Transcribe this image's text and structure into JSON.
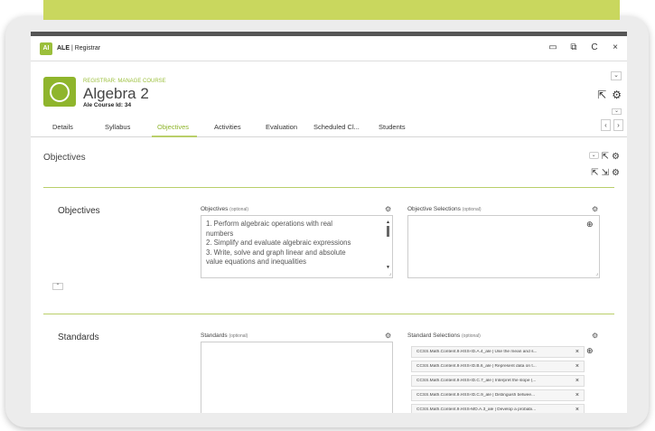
{
  "app": {
    "logo": "AI",
    "title_bold": "ALE",
    "title_rest": " | Registrar",
    "window_controls": [
      "▭",
      "⧉",
      "C",
      "×"
    ]
  },
  "header": {
    "breadcrumb": "REGISTRAR: MANAGE COURSE",
    "course_name": "Algebra 2",
    "course_id": "Ale Course Id: 34",
    "icons": [
      "share-icon",
      "gear-icon"
    ]
  },
  "tabs": [
    "Details",
    "Syllabus",
    "Objectives",
    "Activities",
    "Evaluation",
    "Scheduled Cl...",
    "Students"
  ],
  "active_tab": "Objectives",
  "section": {
    "title": "Objectives"
  },
  "objectives_card": {
    "title": "Objectives",
    "objectives_label": "Objectives",
    "objectives_optional": "(optional)",
    "objectives_lines": [
      "1. Perform algebraic operations with real",
      "numbers",
      "2. Simplify and evaluate algebraic expressions",
      "3. Write, solve and graph linear and absolute",
      "value equations and inequalities"
    ],
    "selections_label": "Objective Selections",
    "selections_optional": "(optional)"
  },
  "standards_card": {
    "title": "Standards",
    "standards_label": "Standards",
    "standards_optional": "(optional)",
    "selections_label": "Standard Selections",
    "selections_optional": "(optional)",
    "selections": [
      "CCSS.Math.Content.9.HSS-ID.A.4_ale | Use the mean and s...",
      "CCSS.Math.Content.9.HSS-ID.B.6_ale | Represent data on t...",
      "CCSS.Math.Content.9.HSS-ID.C.7_ale | Interpret the slope (...",
      "CCSS.Math.Content.9.HSS-ID.C.9_ale | Distinguish betwee...",
      "CCSS.Math.Content.9.HSS-MD.A.3_ale | Develop a probabi..."
    ]
  },
  "colors": {
    "accent": "#8fb52c",
    "banner": "#c9d75e",
    "card_border": "#b9cf6a"
  }
}
